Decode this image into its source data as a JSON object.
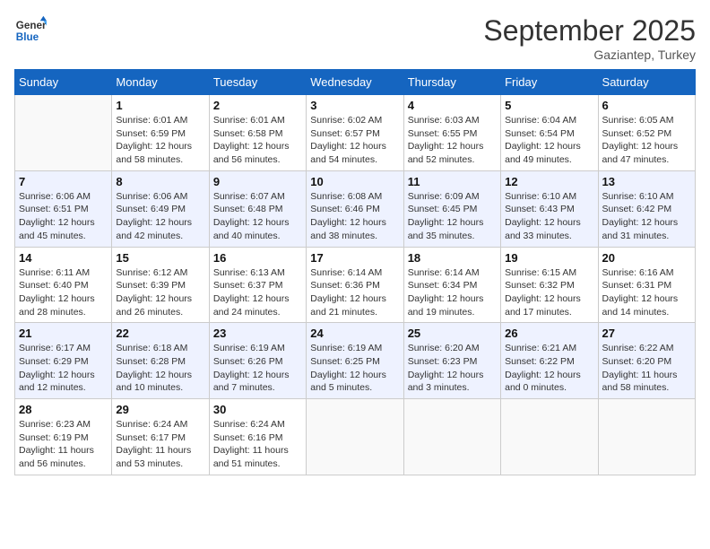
{
  "logo": {
    "line1": "General",
    "line2": "Blue"
  },
  "title": "September 2025",
  "location": "Gaziantep, Turkey",
  "days_header": [
    "Sunday",
    "Monday",
    "Tuesday",
    "Wednesday",
    "Thursday",
    "Friday",
    "Saturday"
  ],
  "weeks": [
    [
      {
        "day": "",
        "sunrise": "",
        "sunset": "",
        "daylight": ""
      },
      {
        "day": "1",
        "sunrise": "Sunrise: 6:01 AM",
        "sunset": "Sunset: 6:59 PM",
        "daylight": "Daylight: 12 hours and 58 minutes."
      },
      {
        "day": "2",
        "sunrise": "Sunrise: 6:01 AM",
        "sunset": "Sunset: 6:58 PM",
        "daylight": "Daylight: 12 hours and 56 minutes."
      },
      {
        "day": "3",
        "sunrise": "Sunrise: 6:02 AM",
        "sunset": "Sunset: 6:57 PM",
        "daylight": "Daylight: 12 hours and 54 minutes."
      },
      {
        "day": "4",
        "sunrise": "Sunrise: 6:03 AM",
        "sunset": "Sunset: 6:55 PM",
        "daylight": "Daylight: 12 hours and 52 minutes."
      },
      {
        "day": "5",
        "sunrise": "Sunrise: 6:04 AM",
        "sunset": "Sunset: 6:54 PM",
        "daylight": "Daylight: 12 hours and 49 minutes."
      },
      {
        "day": "6",
        "sunrise": "Sunrise: 6:05 AM",
        "sunset": "Sunset: 6:52 PM",
        "daylight": "Daylight: 12 hours and 47 minutes."
      }
    ],
    [
      {
        "day": "7",
        "sunrise": "Sunrise: 6:06 AM",
        "sunset": "Sunset: 6:51 PM",
        "daylight": "Daylight: 12 hours and 45 minutes."
      },
      {
        "day": "8",
        "sunrise": "Sunrise: 6:06 AM",
        "sunset": "Sunset: 6:49 PM",
        "daylight": "Daylight: 12 hours and 42 minutes."
      },
      {
        "day": "9",
        "sunrise": "Sunrise: 6:07 AM",
        "sunset": "Sunset: 6:48 PM",
        "daylight": "Daylight: 12 hours and 40 minutes."
      },
      {
        "day": "10",
        "sunrise": "Sunrise: 6:08 AM",
        "sunset": "Sunset: 6:46 PM",
        "daylight": "Daylight: 12 hours and 38 minutes."
      },
      {
        "day": "11",
        "sunrise": "Sunrise: 6:09 AM",
        "sunset": "Sunset: 6:45 PM",
        "daylight": "Daylight: 12 hours and 35 minutes."
      },
      {
        "day": "12",
        "sunrise": "Sunrise: 6:10 AM",
        "sunset": "Sunset: 6:43 PM",
        "daylight": "Daylight: 12 hours and 33 minutes."
      },
      {
        "day": "13",
        "sunrise": "Sunrise: 6:10 AM",
        "sunset": "Sunset: 6:42 PM",
        "daylight": "Daylight: 12 hours and 31 minutes."
      }
    ],
    [
      {
        "day": "14",
        "sunrise": "Sunrise: 6:11 AM",
        "sunset": "Sunset: 6:40 PM",
        "daylight": "Daylight: 12 hours and 28 minutes."
      },
      {
        "day": "15",
        "sunrise": "Sunrise: 6:12 AM",
        "sunset": "Sunset: 6:39 PM",
        "daylight": "Daylight: 12 hours and 26 minutes."
      },
      {
        "day": "16",
        "sunrise": "Sunrise: 6:13 AM",
        "sunset": "Sunset: 6:37 PM",
        "daylight": "Daylight: 12 hours and 24 minutes."
      },
      {
        "day": "17",
        "sunrise": "Sunrise: 6:14 AM",
        "sunset": "Sunset: 6:36 PM",
        "daylight": "Daylight: 12 hours and 21 minutes."
      },
      {
        "day": "18",
        "sunrise": "Sunrise: 6:14 AM",
        "sunset": "Sunset: 6:34 PM",
        "daylight": "Daylight: 12 hours and 19 minutes."
      },
      {
        "day": "19",
        "sunrise": "Sunrise: 6:15 AM",
        "sunset": "Sunset: 6:32 PM",
        "daylight": "Daylight: 12 hours and 17 minutes."
      },
      {
        "day": "20",
        "sunrise": "Sunrise: 6:16 AM",
        "sunset": "Sunset: 6:31 PM",
        "daylight": "Daylight: 12 hours and 14 minutes."
      }
    ],
    [
      {
        "day": "21",
        "sunrise": "Sunrise: 6:17 AM",
        "sunset": "Sunset: 6:29 PM",
        "daylight": "Daylight: 12 hours and 12 minutes."
      },
      {
        "day": "22",
        "sunrise": "Sunrise: 6:18 AM",
        "sunset": "Sunset: 6:28 PM",
        "daylight": "Daylight: 12 hours and 10 minutes."
      },
      {
        "day": "23",
        "sunrise": "Sunrise: 6:19 AM",
        "sunset": "Sunset: 6:26 PM",
        "daylight": "Daylight: 12 hours and 7 minutes."
      },
      {
        "day": "24",
        "sunrise": "Sunrise: 6:19 AM",
        "sunset": "Sunset: 6:25 PM",
        "daylight": "Daylight: 12 hours and 5 minutes."
      },
      {
        "day": "25",
        "sunrise": "Sunrise: 6:20 AM",
        "sunset": "Sunset: 6:23 PM",
        "daylight": "Daylight: 12 hours and 3 minutes."
      },
      {
        "day": "26",
        "sunrise": "Sunrise: 6:21 AM",
        "sunset": "Sunset: 6:22 PM",
        "daylight": "Daylight: 12 hours and 0 minutes."
      },
      {
        "day": "27",
        "sunrise": "Sunrise: 6:22 AM",
        "sunset": "Sunset: 6:20 PM",
        "daylight": "Daylight: 11 hours and 58 minutes."
      }
    ],
    [
      {
        "day": "28",
        "sunrise": "Sunrise: 6:23 AM",
        "sunset": "Sunset: 6:19 PM",
        "daylight": "Daylight: 11 hours and 56 minutes."
      },
      {
        "day": "29",
        "sunrise": "Sunrise: 6:24 AM",
        "sunset": "Sunset: 6:17 PM",
        "daylight": "Daylight: 11 hours and 53 minutes."
      },
      {
        "day": "30",
        "sunrise": "Sunrise: 6:24 AM",
        "sunset": "Sunset: 6:16 PM",
        "daylight": "Daylight: 11 hours and 51 minutes."
      },
      {
        "day": "",
        "sunrise": "",
        "sunset": "",
        "daylight": ""
      },
      {
        "day": "",
        "sunrise": "",
        "sunset": "",
        "daylight": ""
      },
      {
        "day": "",
        "sunrise": "",
        "sunset": "",
        "daylight": ""
      },
      {
        "day": "",
        "sunrise": "",
        "sunset": "",
        "daylight": ""
      }
    ]
  ]
}
